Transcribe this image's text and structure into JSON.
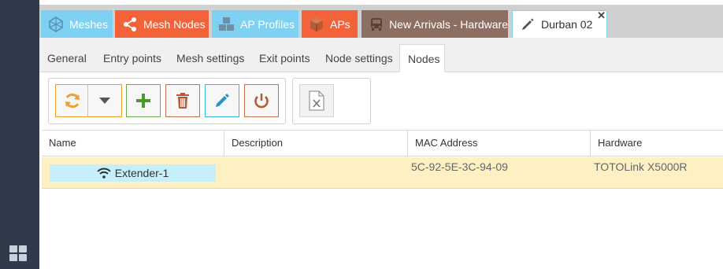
{
  "primary_tabs": [
    {
      "label": "Meshes",
      "icon": "mesh-icon"
    },
    {
      "label": "Mesh Nodes",
      "icon": "share-nodes-icon"
    },
    {
      "label": "AP Profiles",
      "icon": "cubes-icon"
    },
    {
      "label": "APs",
      "icon": "cube-icon"
    },
    {
      "label": "New Arrivals - Hardware",
      "icon": "bus-icon"
    },
    {
      "label": "Durban 02",
      "icon": "pencil-icon",
      "close": "✕"
    }
  ],
  "sub_tabs": [
    "General",
    "Entry points",
    "Mesh settings",
    "Exit points",
    "Node settings",
    "Nodes"
  ],
  "active_sub_tab": "Nodes",
  "toolbar": {
    "buttons": [
      "reload",
      "reload-options",
      "add",
      "delete",
      "edit",
      "power"
    ],
    "export": "csv-export"
  },
  "grid": {
    "columns": [
      "Name",
      "Description",
      "MAC Address",
      "Hardware"
    ],
    "rows": [
      {
        "name": "Extender-1",
        "description": "",
        "mac": "5C-92-5E-3C-94-09",
        "hardware": "TOTOLink X5000R"
      }
    ]
  },
  "colors": {
    "rail": "#2f3b4b",
    "tab_blue": "#7fd1f4",
    "tab_orange": "#f2633a",
    "tab_brown": "#8d6e63",
    "row_selected": "#fdf0c2",
    "name_chip": "#c5f0fb"
  }
}
